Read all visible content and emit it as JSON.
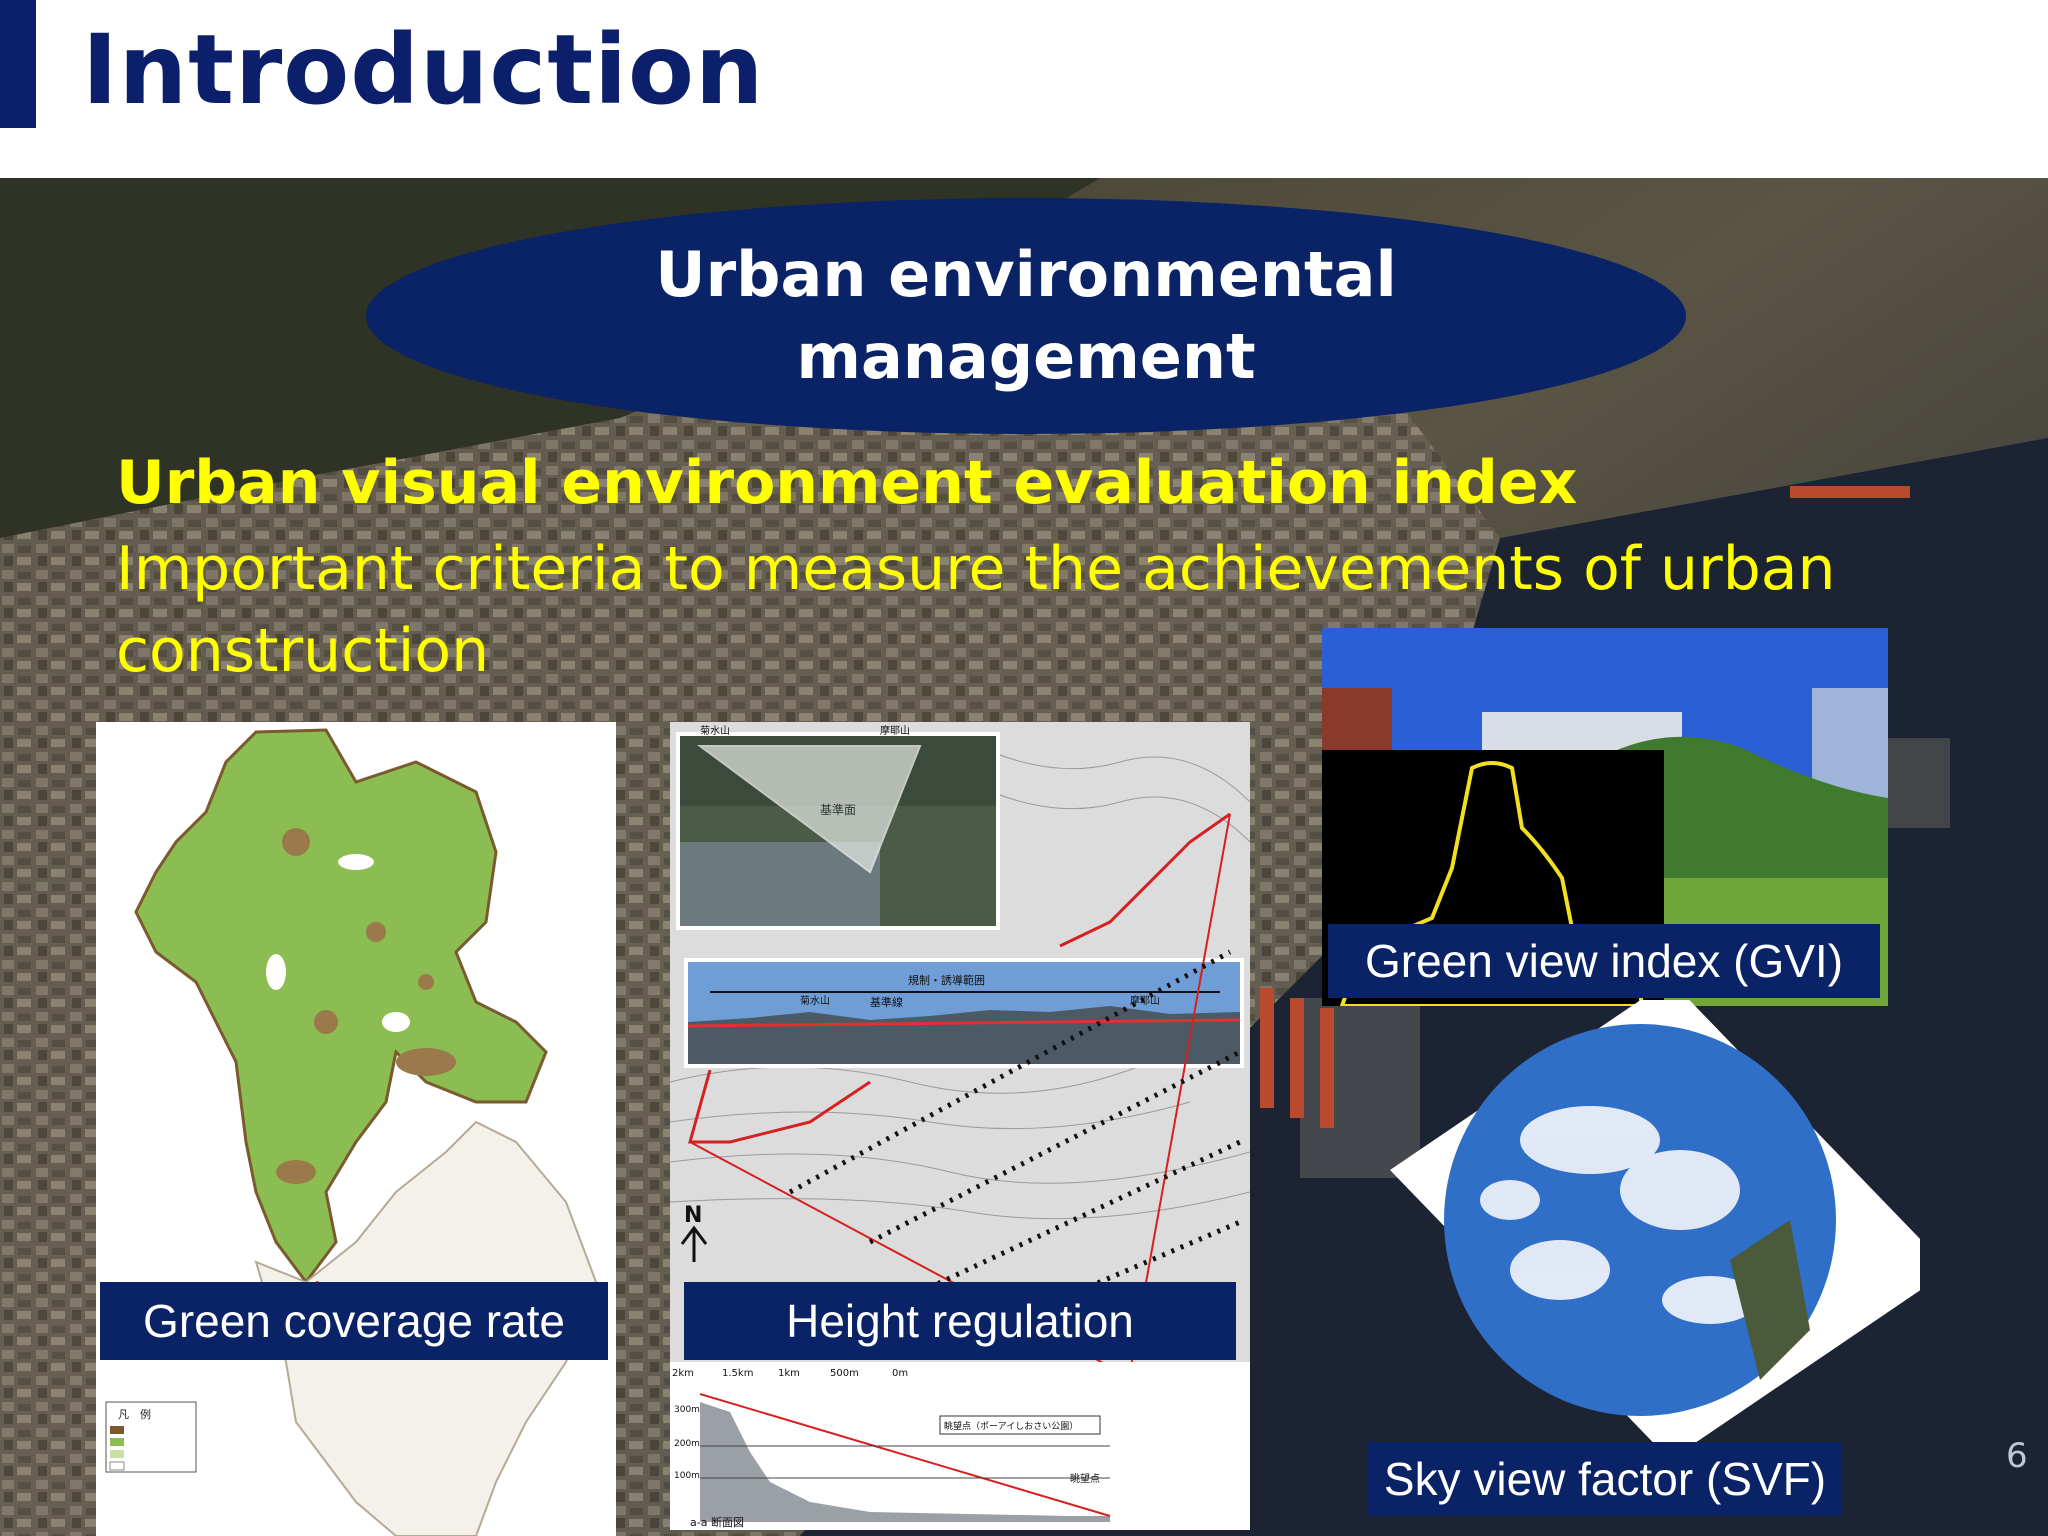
{
  "slide": {
    "title": "Introduction",
    "ellipse_text": "Urban environmental management",
    "subheading": "Urban visual environment evaluation index",
    "subtext": "Important criteria to measure the achievements of urban construction",
    "page_number": "6"
  },
  "panels": {
    "green_coverage": {
      "caption": "Green coverage rate"
    },
    "height_regulation": {
      "caption": "Height regulation"
    },
    "gvi": {
      "caption": "Green view index (GVI)"
    },
    "svf": {
      "caption": "Sky view factor (SVF)"
    }
  },
  "map_labels": {
    "north": "N",
    "dist_scale": [
      "2km",
      "1.5km",
      "1km",
      "500m",
      "0m"
    ],
    "height_ticks": [
      "300m",
      "200m",
      "100m"
    ],
    "section": "a-a 断面図",
    "viewpoint": "眺望点（ポーアイしおさい公園）",
    "viewpoint_short": "眺望点",
    "mountains": [
      "菊水山",
      "摩耶山"
    ],
    "base_plane": "基準面",
    "base_line": "基準線",
    "range": "規制・誘導範囲",
    "legend_title": "凡　例"
  },
  "colors": {
    "navy": "#0a2366",
    "title_navy": "#0b1f6b",
    "yellow": "#ffff00",
    "green": "#8bbd52"
  }
}
